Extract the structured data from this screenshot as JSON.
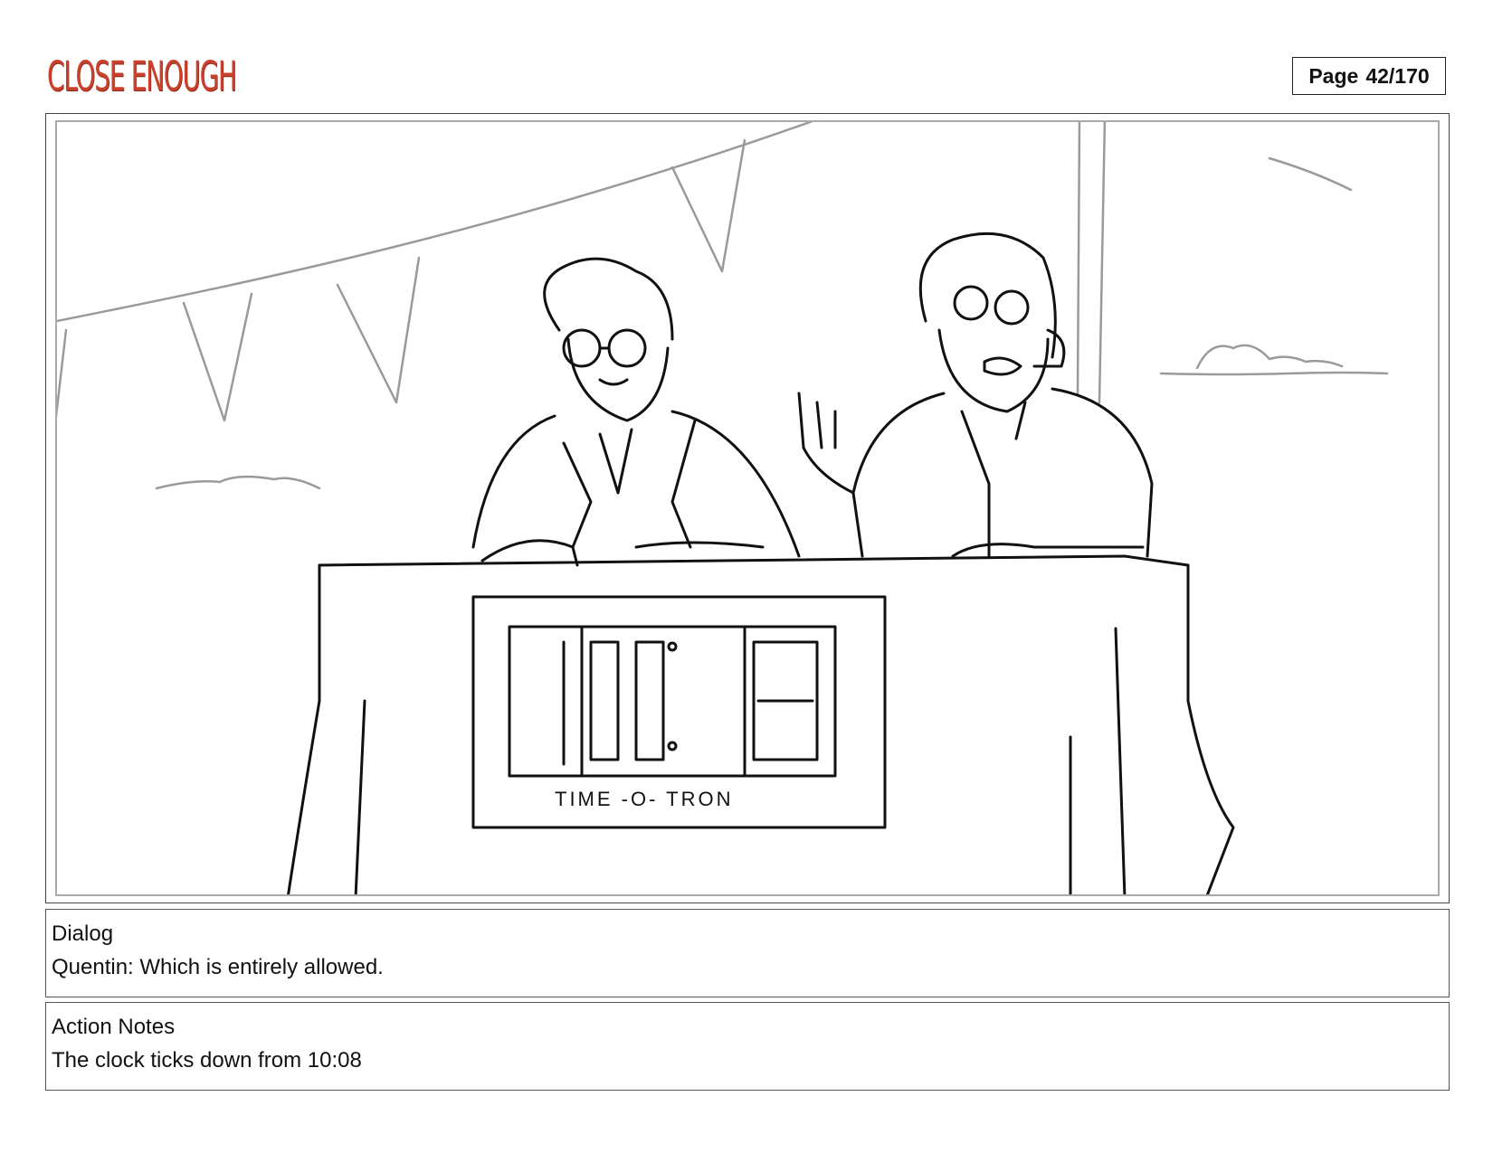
{
  "header": {
    "logo_text": "CLOSE ENOUGH",
    "page_label": "Page",
    "page_number": "42/170"
  },
  "panel": {
    "clock_display": "10:08",
    "clock_caption": "TIME -O- TRON"
  },
  "dialog": {
    "heading": "Dialog",
    "text": "Quentin: Which is entirely allowed."
  },
  "action_notes": {
    "heading": "Action Notes",
    "text": "The clock ticks down from 10:08"
  },
  "colors": {
    "logo": "#c9412c"
  }
}
